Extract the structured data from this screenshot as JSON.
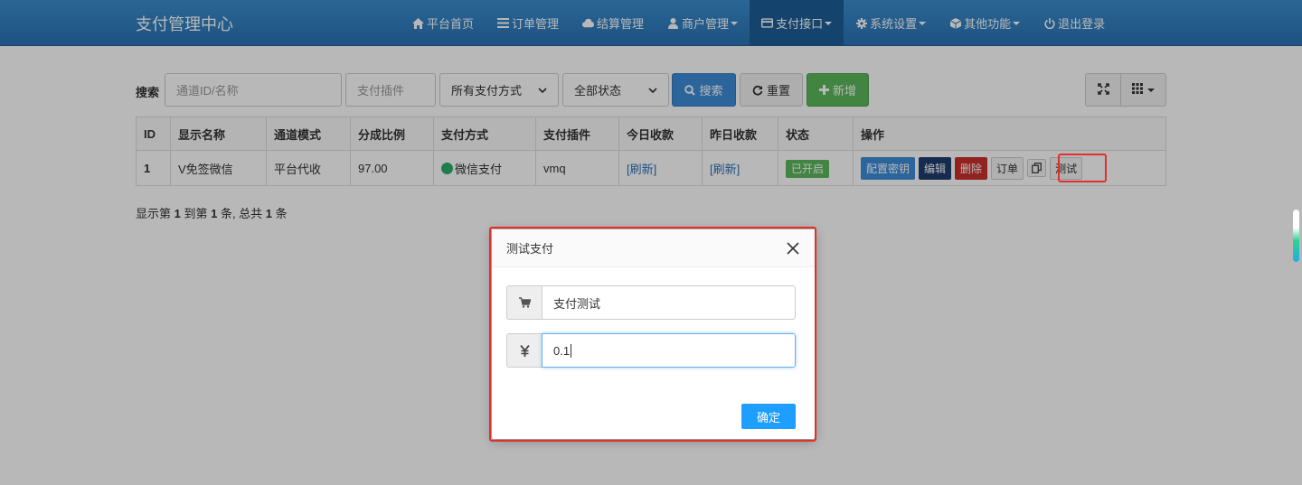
{
  "brand": "支付管理中心",
  "nav": [
    {
      "icon": "home-icon",
      "label": "平台首页",
      "dropdown": false,
      "active": false
    },
    {
      "icon": "list-icon",
      "label": "订单管理",
      "dropdown": false,
      "active": false
    },
    {
      "icon": "cloud-icon",
      "label": "结算管理",
      "dropdown": false,
      "active": false
    },
    {
      "icon": "user-icon",
      "label": "商户管理",
      "dropdown": true,
      "active": false
    },
    {
      "icon": "card-icon",
      "label": "支付接口",
      "dropdown": true,
      "active": true
    },
    {
      "icon": "gear-icon",
      "label": "系统设置",
      "dropdown": true,
      "active": false
    },
    {
      "icon": "cube-icon",
      "label": "其他功能",
      "dropdown": true,
      "active": false
    },
    {
      "icon": "power-icon",
      "label": "退出登录",
      "dropdown": false,
      "active": false
    }
  ],
  "toolbar": {
    "search_label": "搜索",
    "channel_placeholder": "通道ID/名称",
    "plugin_placeholder": "支付插件",
    "method_select": "所有支付方式",
    "status_select": "全部状态",
    "search_button": "搜索",
    "reset_button": "重置",
    "add_button": "新增"
  },
  "table": {
    "headers": [
      "ID",
      "显示名称",
      "通道模式",
      "分成比例",
      "支付方式",
      "支付插件",
      "今日收款",
      "昨日收款",
      "状态",
      "操作"
    ],
    "rows": [
      {
        "id": "1",
        "name": "V免签微信",
        "mode": "平台代收",
        "rate": "97.00",
        "method": "微信支付",
        "plugin": "vmq",
        "today": "[刷新]",
        "yesterday": "[刷新]",
        "status": "已开启",
        "ops": {
          "config": "配置密钥",
          "edit": "编辑",
          "delete": "删除",
          "orders": "订单",
          "test": "测试"
        }
      }
    ]
  },
  "pager": {
    "p1": "显示第 ",
    "n1": "1",
    "p2": " 到第 ",
    "n2": "1",
    "p3": " 条, 总共 ",
    "n3": "1",
    "p4": " 条"
  },
  "modal": {
    "title": "测试支付",
    "name_value": "支付测试",
    "amount_value": "0.1",
    "confirm_button": "确定"
  },
  "colors": {
    "navbar": "#2a72b3",
    "primary": "#3c8dd9",
    "success": "#5cb85c",
    "danger": "#c9302c",
    "confirm": "#1e9fff",
    "highlight": "#e0302a"
  }
}
